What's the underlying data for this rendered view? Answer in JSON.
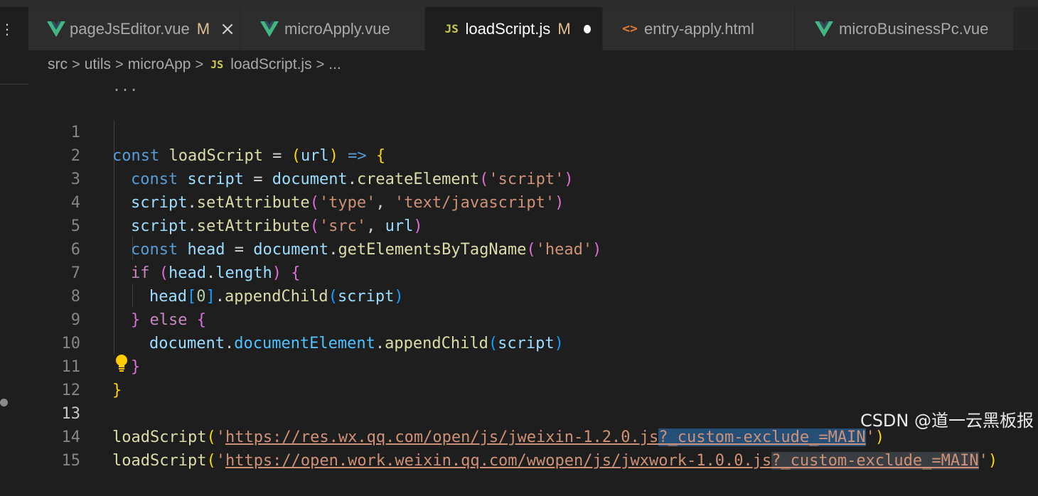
{
  "tabs": [
    {
      "label": "pageJsEditor.vue",
      "icon": "vue-icon",
      "modified": "M",
      "close": "×"
    },
    {
      "label": "microApply.vue",
      "icon": "vue-icon"
    },
    {
      "label": "loadScript.js",
      "icon": "js-icon",
      "icon_text": "JS",
      "modified": "M",
      "active": true
    },
    {
      "label": "entry-apply.html",
      "icon": "html-icon",
      "icon_text": "<>"
    },
    {
      "label": "microBusinessPc.vue",
      "icon": "vue-icon"
    }
  ],
  "breadcrumb": {
    "items": [
      "src",
      "utils",
      "microApp",
      "loadScript.js",
      "..."
    ],
    "sep": ">",
    "js_icon_text": "JS"
  },
  "editor": {
    "fold_dots": "...",
    "line_numbers": [
      "1",
      "2",
      "3",
      "4",
      "5",
      "6",
      "7",
      "8",
      "9",
      "10",
      "11",
      "12",
      "13",
      "14",
      "15"
    ],
    "current_line": "13",
    "code": {
      "l1": {
        "kw": "const",
        "name": "loadScript",
        "eq": " = ",
        "open": "(",
        "param": "url",
        "close": ")",
        "arrow": " => ",
        "brace": "{"
      },
      "l2": {
        "kw": "const",
        "name": "script",
        "eq": " = ",
        "obj": "document",
        "dot": ".",
        "method": "createElement",
        "open": "(",
        "str": "'script'",
        "close": ")"
      },
      "l3": {
        "obj": "script",
        "dot": ".",
        "method": "setAttribute",
        "open": "(",
        "str1": "'type'",
        "comma": ", ",
        "str2": "'text/javascript'",
        "close": ")"
      },
      "l4": {
        "obj": "script",
        "dot": ".",
        "method": "setAttribute",
        "open": "(",
        "str1": "'src'",
        "comma": ", ",
        "arg": "url",
        "close": ")"
      },
      "l5": {
        "kw": "const",
        "name": "head",
        "eq": " = ",
        "obj": "document",
        "dot": ".",
        "method": "getElementsByTagName",
        "open": "(",
        "str": "'head'",
        "close": ")"
      },
      "l6": {
        "kw": "if",
        "open": " (",
        "obj": "head",
        "dot": ".",
        "prop": "length",
        "close": ")",
        "brace": " {"
      },
      "l7": {
        "obj": "head",
        "bo": "[",
        "num": "0",
        "bc": "]",
        "dot": ".",
        "method": "appendChild",
        "open": "(",
        "arg": "script",
        "close": ")"
      },
      "l8": {
        "brace": "}",
        "kw": " else ",
        "brace2": "{"
      },
      "l9": {
        "obj": "document",
        "dot": ".",
        "prop": "documentElement",
        "dot2": ".",
        "method": "appendChild",
        "open": "(",
        "arg": "script",
        "close": ")"
      },
      "l10": {
        "brace": "}"
      },
      "l11": {
        "brace": "}"
      },
      "l13": {
        "fn": "loadScript",
        "open": "(",
        "q": "'",
        "url": "https://res.wx.qq.com/open/js/jweixin-1.2.0.js",
        "query": "?_custom-exclude_=MAIN",
        "q2": "'",
        "close": ")"
      },
      "l14": {
        "fn": "loadScript",
        "open": "(",
        "q": "'",
        "url": "https://open.work.weixin.qq.com/wwopen/js/jwxwork-1.0.0.js",
        "query": "?_custom-exclude_=MAIN",
        "q2": "'",
        "close": ")"
      }
    }
  },
  "watermark": "CSDN @道一云黑板报",
  "colors": {
    "background": "#1e1e1e",
    "vue": "#41b883",
    "js": "#cbcb41",
    "html": "#e37933",
    "selection": "#264f78"
  }
}
